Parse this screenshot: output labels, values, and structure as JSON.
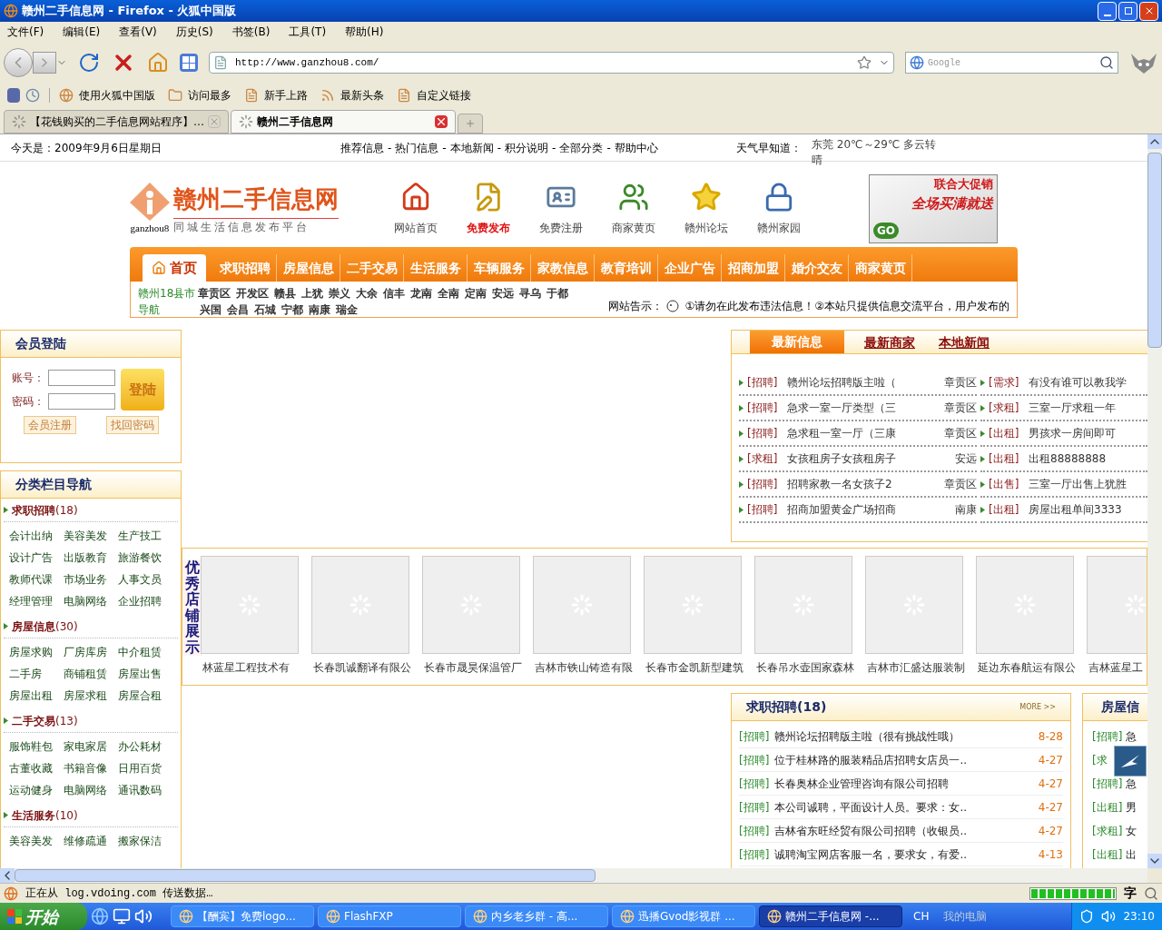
{
  "window": {
    "title": "赣州二手信息网 - Firefox - 火狐中国版"
  },
  "menu": [
    "文件(F)",
    "编辑(E)",
    "查看(V)",
    "历史(S)",
    "书签(B)",
    "工具(T)",
    "帮助(H)"
  ],
  "address": {
    "value": "http://www.ganzhou8.com/"
  },
  "search": {
    "placeholder": "Google"
  },
  "bookmarks": [
    "使用火狐中国版",
    "访问最多",
    "新手上路",
    "最新头条",
    "自定义链接"
  ],
  "tabs": [
    {
      "label": "【花钱购买的二手信息网站程序】…",
      "selected": false
    },
    {
      "label": "赣州二手信息网",
      "selected": true
    }
  ],
  "page": {
    "top_bar": {
      "date": "今天是：2009年9月6日星期日",
      "links": [
        "推荐信息",
        "热门信息",
        "本地新闻",
        "积分说明",
        "全部分类",
        "帮助中心"
      ],
      "separator": "-",
      "weather_label": "天气早知道：",
      "weather": "东莞 20℃～29℃ 多云转晴"
    },
    "logo": {
      "title": "赣州二手信息网",
      "domain": "ganzhou8",
      "tagline": "同城生活信息发布平台"
    },
    "quick_links": [
      {
        "label": "网站首页",
        "kind": "home",
        "highlight": false
      },
      {
        "label": "免费发布",
        "kind": "publish",
        "highlight": true
      },
      {
        "label": "免费注册",
        "kind": "register",
        "highlight": false
      },
      {
        "label": "商家黄页",
        "kind": "people",
        "highlight": false
      },
      {
        "label": "赣州论坛",
        "kind": "star",
        "highlight": false
      },
      {
        "label": "赣州家园",
        "kind": "lock",
        "highlight": false
      }
    ],
    "banner": {
      "line1": "联合大促销",
      "line2": "全场买满就送",
      "go": "GO"
    },
    "nav": [
      {
        "label": "首页",
        "selected": true
      },
      {
        "label": "求职招聘",
        "selected": false
      },
      {
        "label": "房屋信息",
        "selected": false
      },
      {
        "label": "二手交易",
        "selected": false
      },
      {
        "label": "生活服务",
        "selected": false
      },
      {
        "label": "车辆服务",
        "selected": false
      },
      {
        "label": "家教信息",
        "selected": false
      },
      {
        "label": "教育培训",
        "selected": false
      },
      {
        "label": "企业广告",
        "selected": false
      },
      {
        "label": "招商加盟",
        "selected": false
      },
      {
        "label": "婚介交友",
        "selected": false
      },
      {
        "label": "商家黄页",
        "selected": false
      }
    ],
    "sub_nav": {
      "label": "赣州18县市",
      "label2": "导航",
      "areas_line1": [
        "章贡区",
        "开发区",
        "赣县",
        "上犹",
        "崇义",
        "大余",
        "信丰",
        "龙南",
        "全南",
        "定南",
        "安远",
        "寻乌",
        "于都"
      ],
      "areas_line2": [
        "兴国",
        "会昌",
        "石城",
        "宁都",
        "南康",
        "瑞金"
      ],
      "notice_label": "网站告示：",
      "notice": "①请勿在此发布违法信息！②本站只提供信息交流平台，用户发布的"
    },
    "login": {
      "title": "会员登陆",
      "account_label": "账号：",
      "password_label": "密码：",
      "submit": "登陆",
      "register": "会员注册",
      "recover": "找回密码"
    },
    "categories_title": "分类栏目导航",
    "categories": [
      {
        "name": "求职招聘",
        "count": "(18)",
        "items": [
          "会计出纳",
          "美容美发",
          "生产技工",
          "设计广告",
          "出版教育",
          "旅游餐饮",
          "教师代课",
          "市场业务",
          "人事文员",
          "经理管理",
          "电脑网络",
          "企业招聘"
        ]
      },
      {
        "name": "房屋信息",
        "count": "(30)",
        "items": [
          "房屋求购",
          "厂房库房",
          "中介租赁",
          "二手房",
          "商铺租赁",
          "房屋出售",
          "房屋出租",
          "房屋求租",
          "房屋合租"
        ]
      },
      {
        "name": "二手交易",
        "count": "(13)",
        "items": [
          "服饰鞋包",
          "家电家居",
          "办公耗材",
          "古董收藏",
          "书籍音像",
          "日用百货",
          "运动健身",
          "电脑网络",
          "通讯数码"
        ]
      },
      {
        "name": "生活服务",
        "count": "(10)",
        "items": [
          "美容美发",
          "维修疏通",
          "搬家保洁"
        ]
      }
    ],
    "news_tabs": [
      {
        "label": "最新信息",
        "selected": true
      },
      {
        "label": "最新商家",
        "selected": false
      },
      {
        "label": "本地新闻",
        "selected": false
      }
    ],
    "news_left": [
      {
        "tag": "[招聘]",
        "title": "赣州论坛招聘版主啦（",
        "area": "章贡区"
      },
      {
        "tag": "[招聘]",
        "title": "急求一室一厅类型（三",
        "area": "章贡区"
      },
      {
        "tag": "[招聘]",
        "title": "急求租一室一厅（三康",
        "area": "章贡区"
      },
      {
        "tag": "[求租]",
        "title": "女孩租房子女孩租房子",
        "area": "安远"
      },
      {
        "tag": "[招聘]",
        "title": "招聘家教一名女孩子2",
        "area": "章贡区"
      },
      {
        "tag": "[招聘]",
        "title": "招商加盟黄金广场招商",
        "area": "南康"
      }
    ],
    "news_right": [
      {
        "tag": "[需求]",
        "title": "有没有谁可以教我学"
      },
      {
        "tag": "[求租]",
        "title": "三室一厅求租一年"
      },
      {
        "tag": "[出租]",
        "title": "男孩求一房间即可"
      },
      {
        "tag": "[出租]",
        "title": "出租88888888"
      },
      {
        "tag": "[出售]",
        "title": "三室一厅出售上犹胜"
      },
      {
        "tag": "[出租]",
        "title": "房屋出租单间3333"
      }
    ],
    "shops_title": "优秀店铺展示",
    "shops": [
      "林蓝星工程技术有",
      "长春凯诚翻译有限公",
      "长春市晟昊保温管厂",
      "吉林市铁山铸造有限",
      "长春市金凯新型建筑",
      "长春吊水壶国家森林",
      "吉林市汇盛达服装制",
      "延边东春航运有限公",
      "吉林蓝星工"
    ],
    "jobs": {
      "title": "求职招聘(18)",
      "more": "MORE >>",
      "rows": [
        {
          "tag": "[招聘]",
          "title": "赣州论坛招聘版主啦（很有挑战性哦）",
          "date": "8-28"
        },
        {
          "tag": "[招聘]",
          "title": "位于桂林路的服装精品店招聘女店员一..",
          "date": "4-27"
        },
        {
          "tag": "[招聘]",
          "title": "长春奥林企业管理咨询有限公司招聘",
          "date": "4-27"
        },
        {
          "tag": "[招聘]",
          "title": "本公司诚聘，平面设计人员。要求：女..",
          "date": "4-27"
        },
        {
          "tag": "[招聘]",
          "title": "吉林省东旺经贸有限公司招聘（收银员..",
          "date": "4-27"
        },
        {
          "tag": "[招聘]",
          "title": "诚聘淘宝网店客服一名，要求女，有爱..",
          "date": "4-13"
        }
      ]
    },
    "houses": {
      "title": "房屋信",
      "rows": [
        {
          "tag": "[招聘]",
          "title": "急"
        },
        {
          "tag": "[求"
        },
        {
          "tag": "[招聘]",
          "title": "急"
        },
        {
          "tag": "[出租]",
          "title": "男"
        },
        {
          "tag": "[求租]",
          "title": "女"
        },
        {
          "tag": "[出租]",
          "title": "出"
        }
      ]
    }
  },
  "status_bar": {
    "text": "正在从 log.vdoing.com 传送数据…",
    "level": 1,
    "ime": "字"
  },
  "taskbar": {
    "start": "开始",
    "tasks": [
      {
        "label": "【酬宾】免费logo...",
        "selected": false
      },
      {
        "label": "FlashFXP",
        "selected": false
      },
      {
        "label": "内乡老乡群 - 高...",
        "selected": false
      },
      {
        "label": "迅播Gvod影视群 ...",
        "selected": false
      },
      {
        "label": "赣州二手信息网 -...",
        "selected": true
      }
    ],
    "lang": "CH",
    "computer": "我的电脑",
    "clock": "23:10"
  }
}
